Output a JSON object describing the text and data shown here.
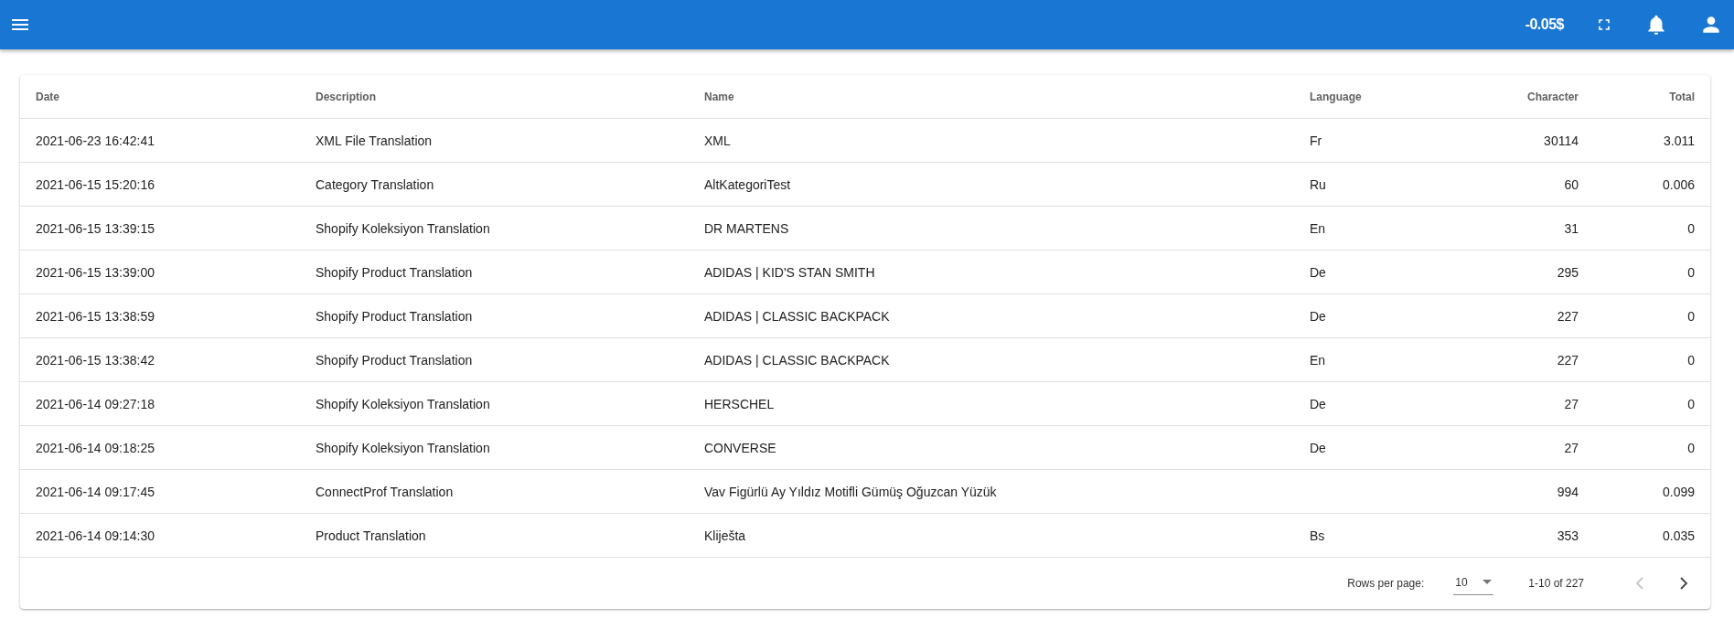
{
  "top_bar": {
    "balance": "-0.05$"
  },
  "table": {
    "columns": [
      {
        "label": "Date",
        "kind": "text"
      },
      {
        "label": "Description",
        "kind": "text"
      },
      {
        "label": "Name",
        "kind": "text"
      },
      {
        "label": "Language",
        "kind": "text"
      },
      {
        "label": "Character",
        "kind": "number"
      },
      {
        "label": "Total",
        "kind": "number"
      }
    ],
    "rows": [
      {
        "cells": [
          "2021-06-23 16:42:41",
          "XML File Translation",
          "XML",
          "Fr",
          "30114",
          "3.011"
        ]
      },
      {
        "cells": [
          "2021-06-15 15:20:16",
          "Category Translation",
          "AltKategoriTest",
          "Ru",
          "60",
          "0.006"
        ]
      },
      {
        "cells": [
          "2021-06-15 13:39:15",
          "Shopify Koleksiyon Translation",
          "DR MARTENS",
          "En",
          "31",
          "0"
        ]
      },
      {
        "cells": [
          "2021-06-15 13:39:00",
          "Shopify Product Translation",
          "ADIDAS | KID'S STAN SMITH",
          "De",
          "295",
          "0"
        ]
      },
      {
        "cells": [
          "2021-06-15 13:38:59",
          "Shopify Product Translation",
          "ADIDAS | CLASSIC BACKPACK",
          "De",
          "227",
          "0"
        ]
      },
      {
        "cells": [
          "2021-06-15 13:38:42",
          "Shopify Product Translation",
          "ADIDAS | CLASSIC BACKPACK",
          "En",
          "227",
          "0"
        ]
      },
      {
        "cells": [
          "2021-06-14 09:27:18",
          "Shopify Koleksiyon Translation",
          "HERSCHEL",
          "De",
          "27",
          "0"
        ]
      },
      {
        "cells": [
          "2021-06-14 09:18:25",
          "Shopify Koleksiyon Translation",
          "CONVERSE",
          "De",
          "27",
          "0"
        ]
      },
      {
        "cells": [
          "2021-06-14 09:17:45",
          "ConnectProf Translation",
          "Vav Figürlü Ay Yıldız Motifli Gümüş Oğuzcan Yüzük",
          null,
          "994",
          "0.099"
        ]
      },
      {
        "cells": [
          "2021-06-14 09:14:30",
          "Product Translation",
          "Kliješta",
          "Bs",
          "353",
          "0.035"
        ]
      }
    ]
  },
  "pagination": {
    "rows_per_page_label": "Rows per page:",
    "rows_per_page": "10",
    "range": "1-10 of 227",
    "prev_disabled": true,
    "next_disabled": false
  }
}
